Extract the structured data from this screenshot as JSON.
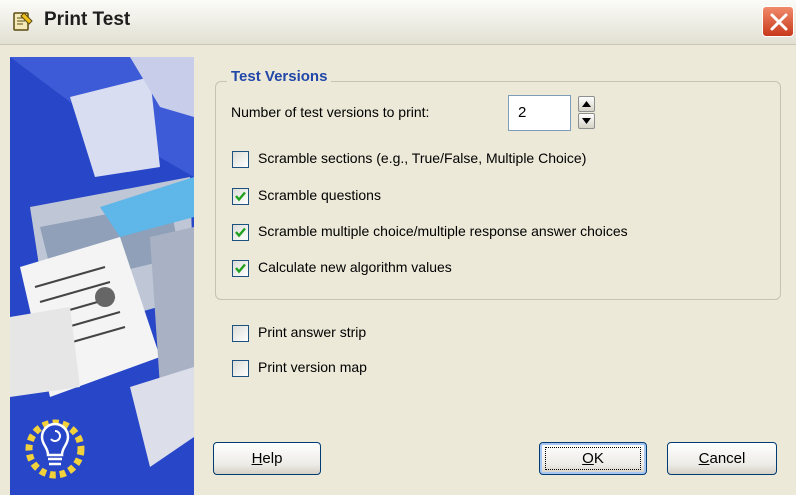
{
  "window": {
    "title": "Print Test"
  },
  "group": {
    "title": "Test Versions",
    "versions_label": "Number of test versions to print:",
    "versions_value": "2"
  },
  "checkboxes": [
    {
      "label": "Scramble sections (e.g., True/False, Multiple Choice)",
      "checked": false
    },
    {
      "label": "Scramble questions",
      "checked": true
    },
    {
      "label": "Scramble multiple choice/multiple response answer choices",
      "checked": true
    },
    {
      "label": "Calculate new algorithm values",
      "checked": true
    },
    {
      "label": "Print answer strip",
      "checked": false
    },
    {
      "label": "Print version map",
      "checked": false
    }
  ],
  "buttons": {
    "help": {
      "mnemonic": "H",
      "rest": "elp"
    },
    "ok": {
      "mnemonic": "O",
      "rest": "K"
    },
    "cancel": {
      "mnemonic": "C",
      "rest": "ancel"
    }
  },
  "colors": {
    "dialog_bg": "#ECE9D8",
    "group_title": "#2147A8",
    "side_art_blue": "#2746C8",
    "close_red": "#C8391A"
  },
  "icons": [
    "printer-test-app-icon",
    "close-icon",
    "spin-up-icon",
    "spin-down-icon",
    "checkmark-icon",
    "lightbulb-logo-icon"
  ]
}
